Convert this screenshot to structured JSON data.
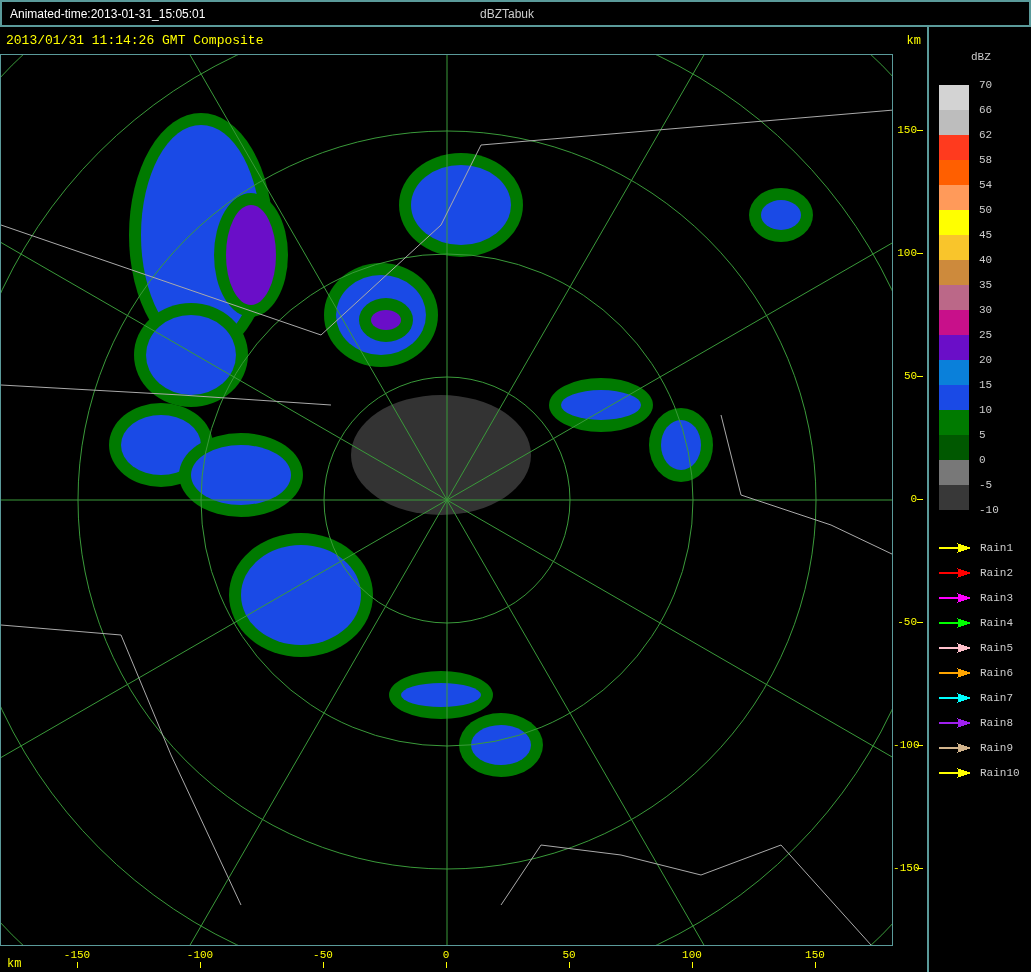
{
  "window": {
    "animation_time": "Animated-time:2013-01-31_15:05:01",
    "title": "dBZTabuk"
  },
  "plot": {
    "heading": "2013/01/31 11:14:26 GMT Composite",
    "y_unit": "km",
    "x_unit": "km",
    "xticks": [
      "-150",
      "-100",
      "-50",
      "0",
      "50",
      "100",
      "150"
    ],
    "yticks": [
      "150",
      "100",
      "50",
      "0",
      "-50",
      "-100",
      "-150"
    ]
  },
  "legend": {
    "unit": "dBZ",
    "labels": [
      "70",
      "66",
      "62",
      "58",
      "54",
      "50",
      "45",
      "40",
      "35",
      "30",
      "25",
      "20",
      "15",
      "10",
      "5",
      "0",
      "-5",
      "-10"
    ],
    "bands": [
      {
        "color": "#d3d3d3"
      },
      {
        "color": "#bdbdbd"
      },
      {
        "color": "#ff3a1e"
      },
      {
        "color": "#ff5f00"
      },
      {
        "color": "#ff9a5a"
      },
      {
        "color": "#ffff00"
      },
      {
        "color": "#f9c52b"
      },
      {
        "color": "#cd8a3c"
      },
      {
        "color": "#bb6888"
      },
      {
        "color": "#c8108a"
      },
      {
        "color": "#6a0ec8"
      },
      {
        "color": "#0a80da"
      },
      {
        "color": "#1a4ae6"
      },
      {
        "color": "#007a00"
      },
      {
        "color": "#005800"
      },
      {
        "color": "#787878"
      },
      {
        "color": "#383838"
      }
    ],
    "tracks": [
      {
        "label": "Rain1",
        "color": "#ffff00"
      },
      {
        "label": "Rain2",
        "color": "#ff0000"
      },
      {
        "label": "Rain3",
        "color": "#ff00ff"
      },
      {
        "label": "Rain4",
        "color": "#00ff00"
      },
      {
        "label": "Rain5",
        "color": "#ffc0cb"
      },
      {
        "label": "Rain6",
        "color": "#ffa500"
      },
      {
        "label": "Rain7",
        "color": "#00ffff"
      },
      {
        "label": "Rain8",
        "color": "#a020f0"
      },
      {
        "label": "Rain9",
        "color": "#d2b48c"
      },
      {
        "label": "Rain10",
        "color": "#ffff00"
      }
    ]
  }
}
